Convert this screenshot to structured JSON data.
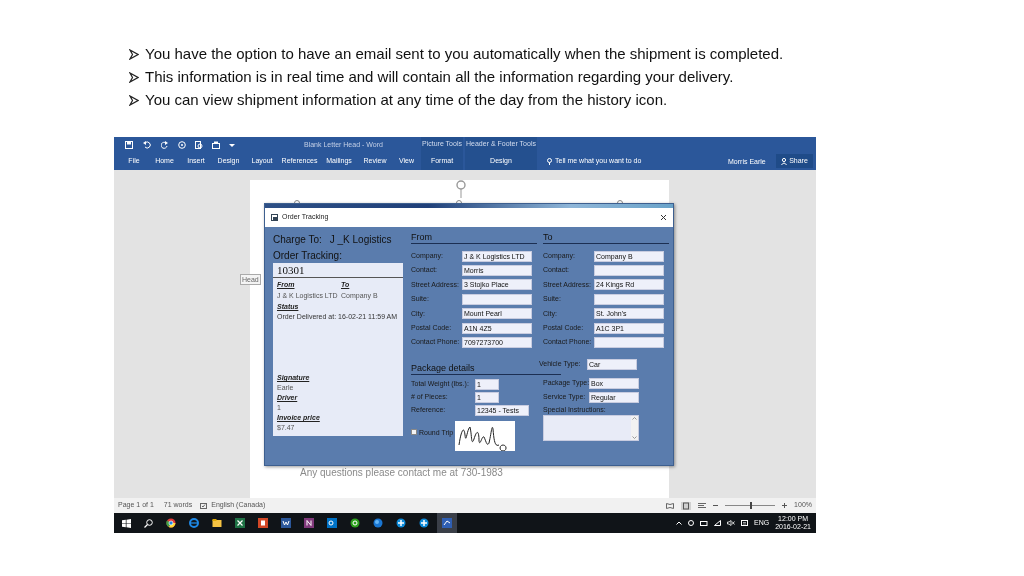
{
  "bullets": [
    "You have the option to have an email sent to you automatically when the shipment is completed.",
    "This information is in real time and will contain all the information regarding your delivery.",
    "You can view shipment information at any time of the day from the history icon."
  ],
  "word": {
    "title": "Blank Letter Head - Word",
    "context_groups": [
      "Picture Tools",
      "Header & Footer Tools"
    ],
    "tabs": [
      {
        "label": "File",
        "kind": "normal"
      },
      {
        "label": "Home",
        "kind": "normal"
      },
      {
        "label": "Insert",
        "kind": "normal"
      },
      {
        "label": "Design",
        "kind": "normal"
      },
      {
        "label": "Layout",
        "kind": "normal"
      },
      {
        "label": "References",
        "kind": "normal"
      },
      {
        "label": "Mailings",
        "kind": "normal"
      },
      {
        "label": "Review",
        "kind": "normal"
      },
      {
        "label": "View",
        "kind": "normal"
      },
      {
        "label": "Format",
        "kind": "contextual"
      },
      {
        "label": "Design",
        "kind": "contextual"
      }
    ],
    "tell_me": "Tell me what you want to do",
    "user": "Morris Earle",
    "share": "Share",
    "header_tag": "Head",
    "footer_text": "Any questions please contact me at 730-1983",
    "status_bar": {
      "page": "Page 1 of 1",
      "words": "71 words",
      "language": "English (Canada)",
      "zoom_slider": {
        "level": 0.5
      },
      "zoom": "100%"
    }
  },
  "dialog": {
    "title": "Order Tracking",
    "charge_to_label": "Charge To:",
    "charge_to_value": "J _K Logistics",
    "order_tracking_label": "Order Tracking:",
    "order_number": "10301",
    "from_label": "From",
    "from_value": "J & K Logistics LTD",
    "to_label": "To",
    "to_value": "Company B",
    "status_label": "Status",
    "status_value": "Order Delivered at: 16-02-21 11:59 AM",
    "summary": [
      {
        "label": "Signature",
        "value": "Earle"
      },
      {
        "label": "Driver",
        "value": "1"
      },
      {
        "label": "Invoice price",
        "value": "$7.47"
      }
    ],
    "addresses": [
      {
        "heading": "From",
        "fields": [
          {
            "label": "Company:",
            "value": "J & K Logistics LTD"
          },
          {
            "label": "Contact:",
            "value": "Morris"
          },
          {
            "label": "Street Address:",
            "value": "3 Stojko Place"
          },
          {
            "label": "Suite:"
          },
          {
            "label": "City:",
            "value": "Mount Pearl"
          },
          {
            "label": "Postal Code:",
            "value": "A1N 4Z5"
          },
          {
            "label": "Contact Phone:",
            "value": "7097273700"
          }
        ]
      },
      {
        "heading": "To",
        "fields": [
          {
            "label": "Company:",
            "value": "Company B"
          },
          {
            "label": "Contact:"
          },
          {
            "label": "Street Address:",
            "value": "24 Kings Rd"
          },
          {
            "label": "Suite:"
          },
          {
            "label": "City:",
            "value": "St. John's"
          },
          {
            "label": "Postal Code:",
            "value": "A1C 3P1"
          },
          {
            "label": "Contact Phone:"
          }
        ]
      }
    ],
    "package_heading": "Package details",
    "package_fields": [
      {
        "label": "Total Weight (lbs.):",
        "value": "1"
      },
      {
        "label": "# of Pieces:",
        "value": "1"
      },
      {
        "label": "Reference:",
        "value": "12345 - Tests"
      }
    ],
    "vehicle_type": {
      "label": "Vehicle Type:",
      "value": "Car"
    },
    "right_fields": [
      {
        "label": "Package Type:",
        "value": "Box"
      },
      {
        "label": "Service Type:",
        "value": "Regular"
      }
    ],
    "special_instructions_label": "Special Instructions:",
    "round_trip": {
      "label": "Round Trip",
      "checked": false
    }
  },
  "taskbar": {
    "language": "ENG",
    "time": "12:00 PM",
    "date": "2016-02-21"
  }
}
